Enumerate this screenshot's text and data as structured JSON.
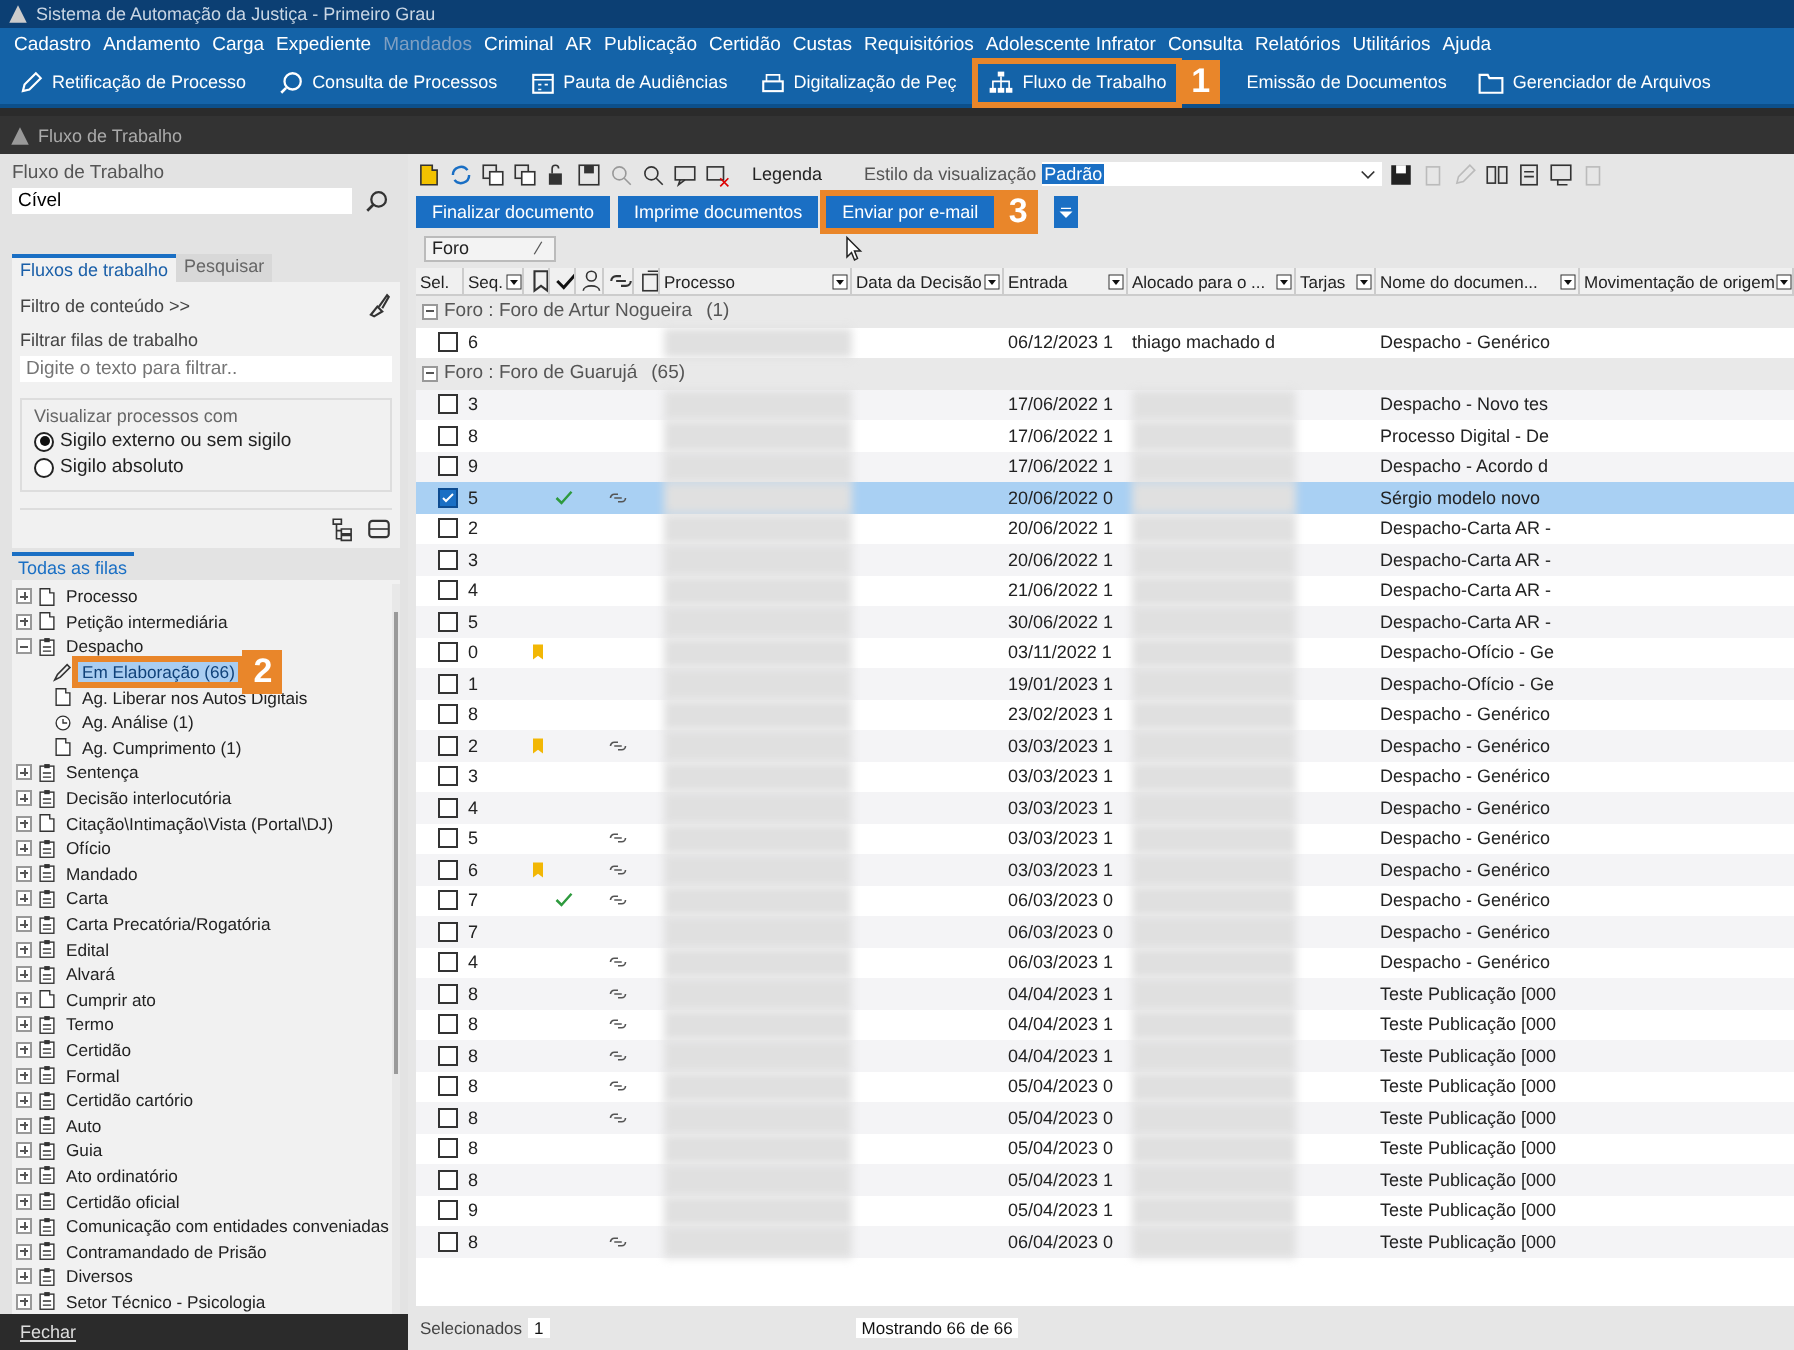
{
  "window": {
    "title": "Sistema de Automação da Justiça - Primeiro Grau"
  },
  "menu": [
    {
      "label": "Cadastro",
      "disabled": false
    },
    {
      "label": "Andamento",
      "disabled": false
    },
    {
      "label": "Carga",
      "disabled": false
    },
    {
      "label": "Expediente",
      "disabled": false
    },
    {
      "label": "Mandados",
      "disabled": true
    },
    {
      "label": "Criminal",
      "disabled": false
    },
    {
      "label": "AR",
      "disabled": false
    },
    {
      "label": "Publicação",
      "disabled": false
    },
    {
      "label": "Certidão",
      "disabled": false
    },
    {
      "label": "Custas",
      "disabled": false
    },
    {
      "label": "Requisitórios",
      "disabled": false
    },
    {
      "label": "Adolescente Infrator",
      "disabled": false
    },
    {
      "label": "Consulta",
      "disabled": false
    },
    {
      "label": "Relatórios",
      "disabled": false
    },
    {
      "label": "Utilitários",
      "disabled": false
    },
    {
      "label": "Ajuda",
      "disabled": false
    }
  ],
  "toolbar": [
    {
      "label": "Retificação de Processo"
    },
    {
      "label": "Consulta de Processos"
    },
    {
      "label": "Pauta de Audiências"
    },
    {
      "label": "Digitalização de Peç"
    },
    {
      "label": "Fluxo de Trabalho",
      "callout": "1"
    },
    {
      "label": "Emissão de Documentos"
    },
    {
      "label": "Gerenciador de Arquivos"
    }
  ],
  "panel_title": "Fluxo de Trabalho",
  "sidebar": {
    "field_label": "Fluxo de Trabalho",
    "field_value": "Cível",
    "tabs": [
      {
        "label": "Fluxos de trabalho",
        "selected": true
      },
      {
        "label": "Pesquisar",
        "selected": false
      }
    ],
    "content_filter": "Filtro de conteúdo >>",
    "filter_label": "Filtrar filas de trabalho",
    "filter_placeholder": "Digite o texto para filtrar..",
    "visibility_legend": "Visualizar processos com",
    "visibility_options": [
      {
        "label": "Sigilo externo ou sem sigilo",
        "selected": true
      },
      {
        "label": "Sigilo absoluto",
        "selected": false
      }
    ],
    "queue_tab": "Todas as filas",
    "tree": [
      {
        "label": "Processo",
        "kind": "document",
        "expanded": false
      },
      {
        "label": "Petição intermediária",
        "kind": "document",
        "expanded": false
      },
      {
        "label": "Despacho",
        "kind": "clipboard",
        "expanded": true,
        "children": [
          {
            "label": "Em Elaboração (66)",
            "kind": "pen",
            "selected": true,
            "callout": "2"
          },
          {
            "label": "Ag. Liberar nos Autos Digitais",
            "kind": "document",
            "selected": false
          },
          {
            "label": "Ag. Análise (1)",
            "kind": "clock",
            "selected": false
          },
          {
            "label": "Ag. Cumprimento (1)",
            "kind": "document",
            "selected": false
          }
        ]
      },
      {
        "label": "Sentença",
        "kind": "clipboard",
        "expanded": false
      },
      {
        "label": "Decisão interlocutória",
        "kind": "clipboard",
        "expanded": false
      },
      {
        "label": "Citação\\Intimação\\Vista (Portal\\DJ)",
        "kind": "document",
        "expanded": false
      },
      {
        "label": "Ofício",
        "kind": "clipboard",
        "expanded": false
      },
      {
        "label": "Mandado",
        "kind": "clipboard",
        "expanded": false
      },
      {
        "label": "Carta",
        "kind": "clipboard",
        "expanded": false
      },
      {
        "label": "Carta Precatória/Rogatória",
        "kind": "clipboard",
        "expanded": false
      },
      {
        "label": "Edital",
        "kind": "clipboard",
        "expanded": false
      },
      {
        "label": "Alvará",
        "kind": "clipboard",
        "expanded": false
      },
      {
        "label": "Cumprir ato",
        "kind": "document",
        "expanded": false
      },
      {
        "label": "Termo",
        "kind": "clipboard",
        "expanded": false
      },
      {
        "label": "Certidão",
        "kind": "clipboard",
        "expanded": false
      },
      {
        "label": "Formal",
        "kind": "clipboard",
        "expanded": false
      },
      {
        "label": "Certidão cartório",
        "kind": "clipboard",
        "expanded": false
      },
      {
        "label": "Auto",
        "kind": "clipboard",
        "expanded": false
      },
      {
        "label": "Guia",
        "kind": "clipboard",
        "expanded": false
      },
      {
        "label": "Ato ordinatório",
        "kind": "clipboard",
        "expanded": false
      },
      {
        "label": "Certidão oficial",
        "kind": "clipboard",
        "expanded": false
      },
      {
        "label": "Comunicação com entidades conveniadas",
        "kind": "clipboard",
        "expanded": false
      },
      {
        "label": "Contramandado de Prisão",
        "kind": "clipboard",
        "expanded": false
      },
      {
        "label": "Diversos",
        "kind": "clipboard",
        "expanded": false
      },
      {
        "label": "Setor Técnico - Psicologia",
        "kind": "clipboard",
        "expanded": false
      }
    ],
    "close_button": "Fechar"
  },
  "main": {
    "legend": "Legenda",
    "style_label": "Estilo da visualização",
    "style_value": "Padrão",
    "actions": [
      {
        "label": "Finalizar documento"
      },
      {
        "label": "Imprime documentos"
      },
      {
        "label": "Enviar por e-mail",
        "callout": "3"
      }
    ],
    "group_chip": "Foro",
    "columns": [
      "Sel.",
      "Seq.",
      "Processo",
      "Data da Decisão",
      "Entrada",
      "Alocado para o ...",
      "Tarjas",
      "Nome do documen...",
      "Movimentação de origem"
    ],
    "groups": [
      {
        "label": "Foro : Foro de Artur Nogueira",
        "count": "(1)",
        "expanded": true,
        "rows": [
          {
            "seq": "6",
            "entrada": "06/12/2023 1",
            "alocado": "thiago machado d",
            "document": "Despacho - Genérico",
            "checked": false,
            "selected": false,
            "bookmarked": false,
            "done": false,
            "linked": false
          }
        ]
      },
      {
        "label": "Foro : Foro de Guarujá",
        "count": "(65)",
        "expanded": true,
        "rows": [
          {
            "seq": "3",
            "entrada": "17/06/2022 1",
            "document": "Despacho - Novo tes",
            "checked": false,
            "selected": false,
            "bookmarked": false,
            "done": false,
            "linked": false
          },
          {
            "seq": "8",
            "entrada": "17/06/2022 1",
            "document": "Processo Digital - De",
            "checked": false,
            "selected": false,
            "bookmarked": false,
            "done": false,
            "linked": false
          },
          {
            "seq": "9",
            "entrada": "17/06/2022 1",
            "document": "Despacho - Acordo d",
            "checked": false,
            "selected": false,
            "bookmarked": false,
            "done": false,
            "linked": false
          },
          {
            "seq": "5",
            "entrada": "20/06/2022 0",
            "document": "Sérgio modelo novo",
            "checked": true,
            "selected": true,
            "bookmarked": false,
            "done": true,
            "linked": true
          },
          {
            "seq": "2",
            "entrada": "20/06/2022 1",
            "document": "Despacho-Carta AR -",
            "checked": false,
            "selected": false,
            "bookmarked": false,
            "done": false,
            "linked": false
          },
          {
            "seq": "3",
            "entrada": "20/06/2022 1",
            "document": "Despacho-Carta AR -",
            "checked": false,
            "selected": false,
            "bookmarked": false,
            "done": false,
            "linked": false
          },
          {
            "seq": "4",
            "entrada": "21/06/2022 1",
            "document": "Despacho-Carta AR -",
            "checked": false,
            "selected": false,
            "bookmarked": false,
            "done": false,
            "linked": false
          },
          {
            "seq": "5",
            "entrada": "30/06/2022 1",
            "document": "Despacho-Carta AR -",
            "checked": false,
            "selected": false,
            "bookmarked": false,
            "done": false,
            "linked": false
          },
          {
            "seq": "0",
            "entrada": "03/11/2022 1",
            "document": "Despacho-Ofício - Ge",
            "checked": false,
            "selected": false,
            "bookmarked": true,
            "done": false,
            "linked": false
          },
          {
            "seq": "1",
            "entrada": "19/01/2023 1",
            "document": "Despacho-Ofício - Ge",
            "checked": false,
            "selected": false,
            "bookmarked": false,
            "done": false,
            "linked": false
          },
          {
            "seq": "8",
            "entrada": "23/02/2023 1",
            "document": "Despacho - Genérico",
            "checked": false,
            "selected": false,
            "bookmarked": false,
            "done": false,
            "linked": false
          },
          {
            "seq": "2",
            "entrada": "03/03/2023 1",
            "document": "Despacho - Genérico",
            "checked": false,
            "selected": false,
            "bookmarked": true,
            "done": false,
            "linked": true
          },
          {
            "seq": "3",
            "entrada": "03/03/2023 1",
            "document": "Despacho - Genérico",
            "checked": false,
            "selected": false,
            "bookmarked": false,
            "done": false,
            "linked": false
          },
          {
            "seq": "4",
            "entrada": "03/03/2023 1",
            "document": "Despacho - Genérico",
            "checked": false,
            "selected": false,
            "bookmarked": false,
            "done": false,
            "linked": false
          },
          {
            "seq": "5",
            "entrada": "03/03/2023 1",
            "document": "Despacho - Genérico",
            "checked": false,
            "selected": false,
            "bookmarked": false,
            "done": false,
            "linked": true
          },
          {
            "seq": "6",
            "entrada": "03/03/2023 1",
            "document": "Despacho - Genérico",
            "checked": false,
            "selected": false,
            "bookmarked": true,
            "done": false,
            "linked": true
          },
          {
            "seq": "7",
            "entrada": "06/03/2023 0",
            "document": "Despacho - Genérico",
            "checked": false,
            "selected": false,
            "bookmarked": false,
            "done": true,
            "linked": true
          },
          {
            "seq": "7",
            "entrada": "06/03/2023 0",
            "document": "Despacho - Genérico",
            "checked": false,
            "selected": false,
            "bookmarked": false,
            "done": false,
            "linked": false
          },
          {
            "seq": "4",
            "entrada": "06/03/2023 1",
            "document": "Despacho - Genérico",
            "checked": false,
            "selected": false,
            "bookmarked": false,
            "done": false,
            "linked": true
          },
          {
            "seq": "8",
            "entrada": "04/04/2023 1",
            "document": "Teste Publicação [000",
            "checked": false,
            "selected": false,
            "bookmarked": false,
            "done": false,
            "linked": true
          },
          {
            "seq": "8",
            "entrada": "04/04/2023 1",
            "document": "Teste Publicação [000",
            "checked": false,
            "selected": false,
            "bookmarked": false,
            "done": false,
            "linked": true
          },
          {
            "seq": "8",
            "entrada": "04/04/2023 1",
            "document": "Teste Publicação [000",
            "checked": false,
            "selected": false,
            "bookmarked": false,
            "done": false,
            "linked": true
          },
          {
            "seq": "8",
            "entrada": "05/04/2023 0",
            "document": "Teste Publicação [000",
            "checked": false,
            "selected": false,
            "bookmarked": false,
            "done": false,
            "linked": true
          },
          {
            "seq": "8",
            "entrada": "05/04/2023 0",
            "document": "Teste Publicação [000",
            "checked": false,
            "selected": false,
            "bookmarked": false,
            "done": false,
            "linked": true
          },
          {
            "seq": "8",
            "entrada": "05/04/2023 0",
            "document": "Teste Publicação [000",
            "checked": false,
            "selected": false,
            "bookmarked": false,
            "done": false,
            "linked": false
          },
          {
            "seq": "8",
            "entrada": "05/04/2023 1",
            "document": "Teste Publicação [000",
            "checked": false,
            "selected": false,
            "bookmarked": false,
            "done": false,
            "linked": false
          },
          {
            "seq": "9",
            "entrada": "05/04/2023 1",
            "document": "Teste Publicação [000",
            "checked": false,
            "selected": false,
            "bookmarked": false,
            "done": false,
            "linked": false
          },
          {
            "seq": "8",
            "entrada": "06/04/2023 0",
            "document": "Teste Publicação [000",
            "checked": false,
            "selected": false,
            "bookmarked": false,
            "done": false,
            "linked": true
          }
        ]
      }
    ],
    "status": {
      "selected_label": "Selecionados",
      "selected_count": "1",
      "showing": "Mostrando 66 de 66"
    }
  }
}
